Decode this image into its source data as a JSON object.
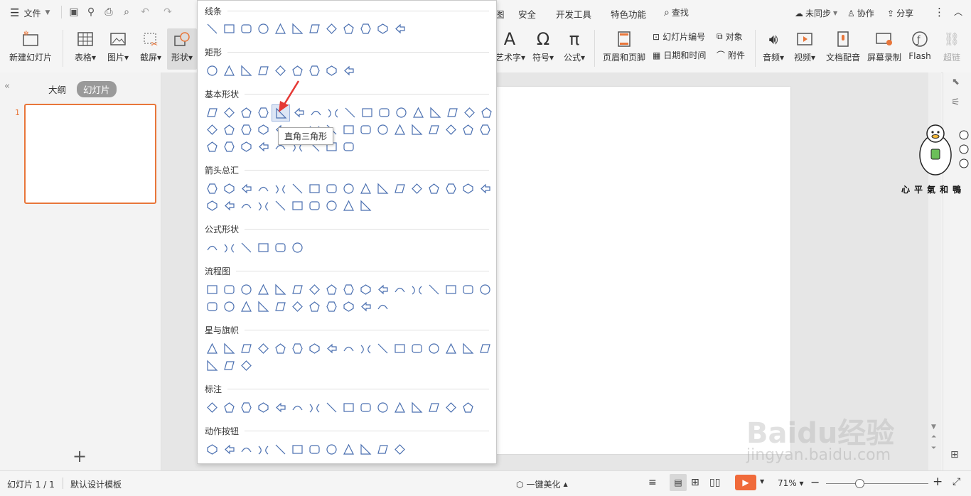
{
  "quick": {
    "file_label": "文件"
  },
  "tabs": [
    "安全",
    "开发工具",
    "特色功能"
  ],
  "search_label": "查找",
  "top_right": {
    "sync": "未同步",
    "collab": "协作",
    "share": "分享"
  },
  "ribbon": {
    "new_slide": "新建幻灯片",
    "table": "表格",
    "picture": "图片",
    "screenshot": "截屏",
    "shape": "形状",
    "art_text": "艺术字",
    "symbol": "符号",
    "formula": "公式",
    "header_footer": "页眉和页脚",
    "slide_number": "幻灯片编号",
    "object": "对象",
    "date_time": "日期和时间",
    "attachment": "附件",
    "audio": "音频",
    "video": "视频",
    "text_dub": "文档配音",
    "screen_record": "屏幕录制",
    "flash": "Flash",
    "hyperlink": "超链"
  },
  "left_panel": {
    "outline_tab": "大纲",
    "slides_tab": "幻灯片",
    "slide_number": "1",
    "add": "+"
  },
  "shapes_panel": {
    "sections": [
      "线条",
      "矩形",
      "基本形状",
      "箭头总汇",
      "公式形状",
      "流程图",
      "星与旗帜",
      "标注",
      "动作按钮"
    ],
    "tooltip": "直角三角形"
  },
  "status": {
    "slide_count": "幻灯片 1 / 1",
    "template": "默认设计模板",
    "beautify": "一键美化",
    "zoom": "71%"
  },
  "watermark": {
    "site": "jingyan.baidu.com",
    "logo_text": "Baidu经验",
    "sticker_text": "心平氣和鴨"
  },
  "colors": {
    "accent": "#e8763a",
    "shape_stroke": "#4a6fb0",
    "play": "#f06a3a"
  }
}
